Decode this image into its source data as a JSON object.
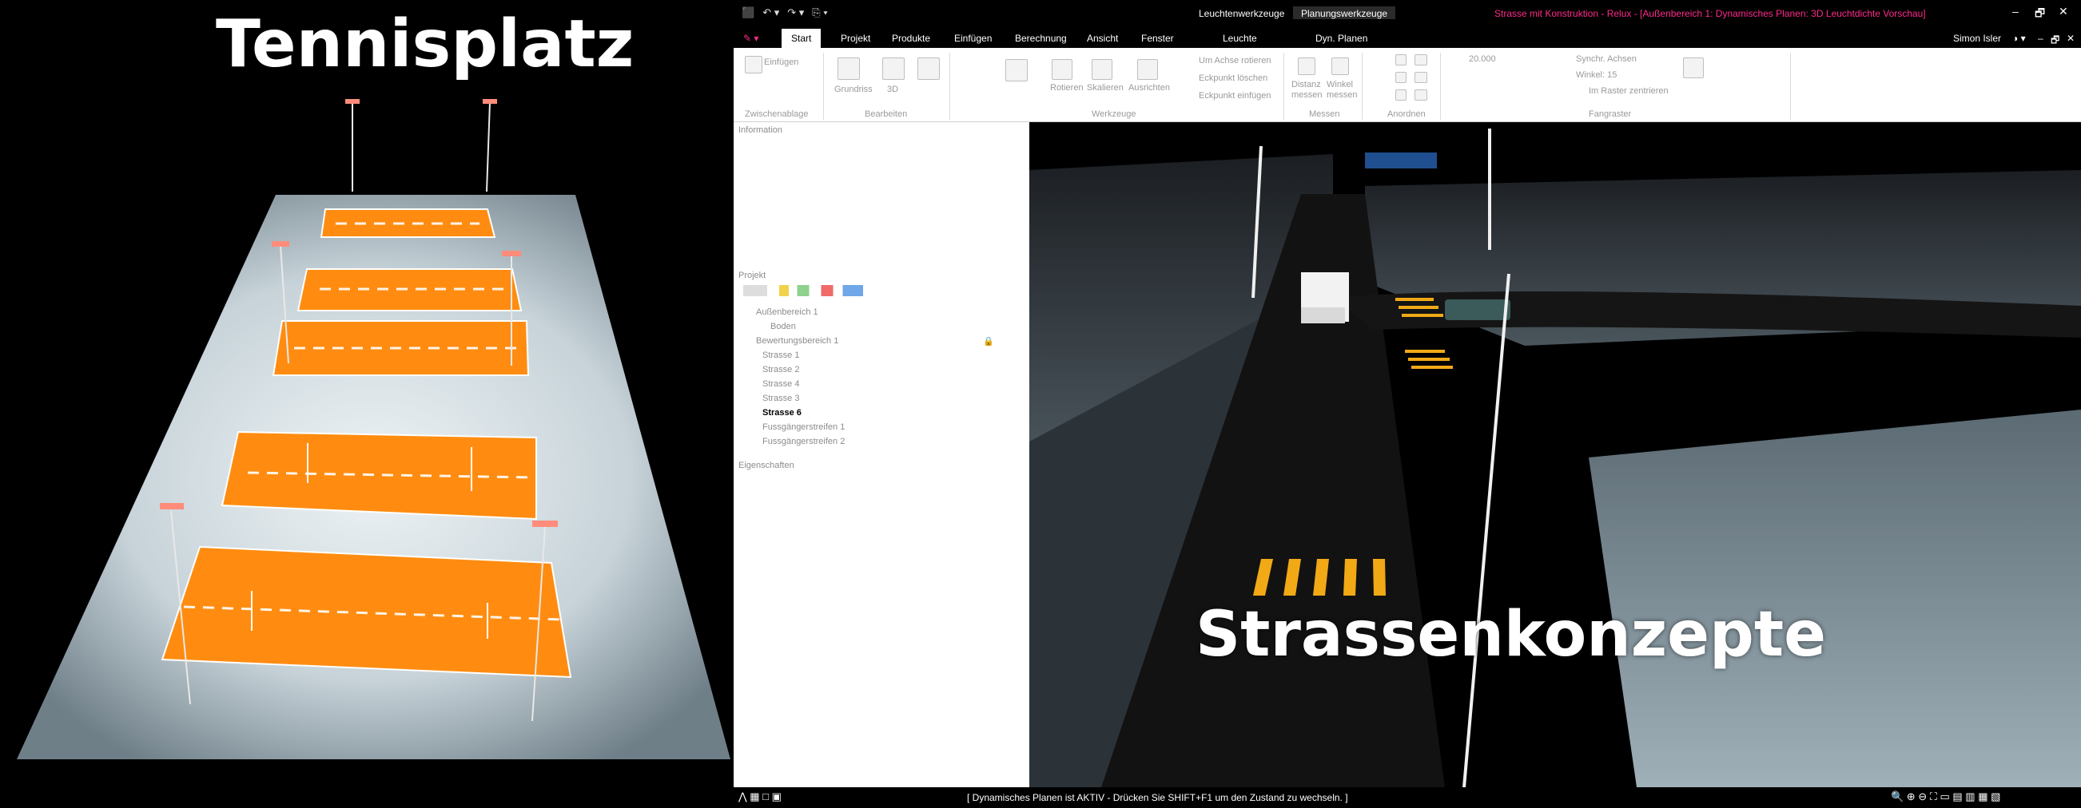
{
  "left_panel": {
    "caption": "Tennisplatz"
  },
  "right_panel": {
    "caption": "Strassenkonzepte"
  },
  "titlebar": {
    "quick_access": [
      "⬛",
      "↶ ▾",
      "↷ ▾",
      "⎘ ▾"
    ],
    "context_tab_1": "Leuchtenwerkzeuge",
    "context_tab_2": "Planungswerkzeuge",
    "document_title": "Strasse mit Konstruktion - Relux - [Außenbereich 1: Dynamisches Planen: 3D Leuchtdichte Vorschau]",
    "window_controls": [
      "–",
      "🗗",
      "✕"
    ]
  },
  "menubar": {
    "app_menu": "✎ ▾",
    "items": [
      "Start",
      "Projekt",
      "Produkte",
      "Einfügen",
      "Berechnung",
      "Ansicht",
      "Fenster",
      "Leuchte",
      "Dyn. Planen"
    ],
    "user": "Simon Isler",
    "extras": [
      "◑ ▾",
      "–",
      "🗗",
      "✕"
    ]
  },
  "ribbon": {
    "clipboard": {
      "button": "Einfügen",
      "group": "Zwischenablage"
    },
    "edit": {
      "buttons": [
        "Grundriss",
        "3D"
      ],
      "group": "Bearbeiten"
    },
    "tools": {
      "buttons": [
        "Rotieren",
        "Skalieren",
        "Ausrichten"
      ],
      "small": [
        "Um Achse rotieren",
        "Eckpunkt löschen",
        "Eckpunkt einfügen"
      ],
      "group": "Werkzeuge"
    },
    "measure": {
      "buttons": [
        "Distanz messen",
        "Winkel messen"
      ],
      "group": "Messen"
    },
    "arrange": {
      "group": "Anordnen"
    },
    "snap": {
      "grid_value": "20.000",
      "synch": "Synchr. Achsen",
      "angle": "Winkel: 15",
      "center": "Im Raster zentrieren",
      "group": "Fangraster"
    }
  },
  "panel": {
    "information_label": "Information",
    "project_label": "Projekt",
    "properties_label": "Eigenschaften",
    "tree": [
      {
        "label": "Außenbereich 1",
        "bold": false
      },
      {
        "label": "Boden",
        "bold": false
      },
      {
        "label": "Bewertungsbereich 1",
        "bold": false
      },
      {
        "label": "Strasse 1",
        "bold": false
      },
      {
        "label": "Strasse 2",
        "bold": false
      },
      {
        "label": "Strasse 4",
        "bold": false
      },
      {
        "label": "Strasse 3",
        "bold": false
      },
      {
        "label": "Strasse 6",
        "bold": true
      },
      {
        "label": "Fussgängerstreifen 1",
        "bold": false
      },
      {
        "label": "Fussgängerstreifen 2",
        "bold": false
      }
    ]
  },
  "statusbar": {
    "message": "[ Dynamisches Planen ist AKTIV - Drücken Sie SHIFT+F1 um den Zustand zu wechseln. ]"
  },
  "colors": {
    "court": "#ff8c10",
    "pink_title": "#ff2a8a",
    "crosswalk": "#f2a916"
  }
}
